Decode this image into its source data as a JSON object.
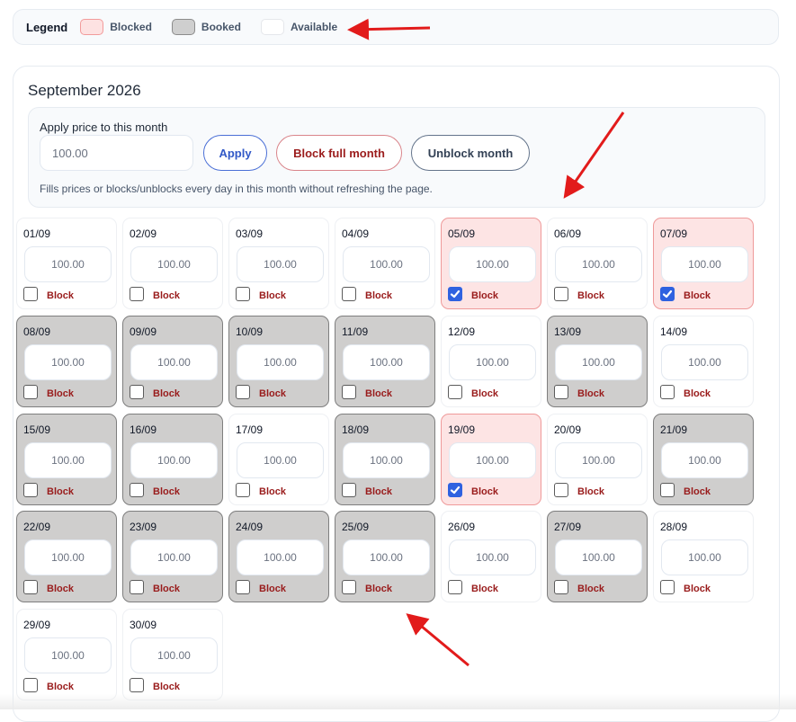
{
  "legend": {
    "title": "Legend",
    "blocked_label": "Blocked",
    "booked_label": "Booked",
    "available_label": "Available",
    "colors": {
      "blocked": "#fde2e2",
      "booked": "#cfcfcf",
      "available": "#ffffff"
    }
  },
  "month": {
    "title": "September 2026",
    "apply_label": "Apply price to this month",
    "price_placeholder": "100.00",
    "apply_button": "Apply",
    "block_month_button": "Block full month",
    "unblock_month_button": "Unblock month",
    "help_text": "Fills prices or blocks/unblocks every day in this month without refreshing the page."
  },
  "day_block_label": "Block",
  "days": [
    {
      "date": "01/09",
      "placeholder": "100.00",
      "status": "available",
      "blocked": false
    },
    {
      "date": "02/09",
      "placeholder": "100.00",
      "status": "available",
      "blocked": false
    },
    {
      "date": "03/09",
      "placeholder": "100.00",
      "status": "available",
      "blocked": false
    },
    {
      "date": "04/09",
      "placeholder": "100.00",
      "status": "available",
      "blocked": false
    },
    {
      "date": "05/09",
      "placeholder": "100.00",
      "status": "blocked",
      "blocked": true
    },
    {
      "date": "06/09",
      "placeholder": "100.00",
      "status": "available",
      "blocked": false
    },
    {
      "date": "07/09",
      "placeholder": "100.00",
      "status": "blocked",
      "blocked": true
    },
    {
      "date": "08/09",
      "placeholder": "100.00",
      "status": "booked",
      "blocked": false
    },
    {
      "date": "09/09",
      "placeholder": "100.00",
      "status": "booked",
      "blocked": false
    },
    {
      "date": "10/09",
      "placeholder": "100.00",
      "status": "booked",
      "blocked": false
    },
    {
      "date": "11/09",
      "placeholder": "100.00",
      "status": "booked",
      "blocked": false
    },
    {
      "date": "12/09",
      "placeholder": "100.00",
      "status": "available",
      "blocked": false
    },
    {
      "date": "13/09",
      "placeholder": "100.00",
      "status": "booked",
      "blocked": false
    },
    {
      "date": "14/09",
      "placeholder": "100.00",
      "status": "available",
      "blocked": false
    },
    {
      "date": "15/09",
      "placeholder": "100.00",
      "status": "booked",
      "blocked": false
    },
    {
      "date": "16/09",
      "placeholder": "100.00",
      "status": "booked",
      "blocked": false
    },
    {
      "date": "17/09",
      "placeholder": "100.00",
      "status": "available",
      "blocked": false
    },
    {
      "date": "18/09",
      "placeholder": "100.00",
      "status": "booked",
      "blocked": false
    },
    {
      "date": "19/09",
      "placeholder": "100.00",
      "status": "blocked",
      "blocked": true
    },
    {
      "date": "20/09",
      "placeholder": "100.00",
      "status": "available",
      "blocked": false
    },
    {
      "date": "21/09",
      "placeholder": "100.00",
      "status": "booked",
      "blocked": false
    },
    {
      "date": "22/09",
      "placeholder": "100.00",
      "status": "booked",
      "blocked": false
    },
    {
      "date": "23/09",
      "placeholder": "100.00",
      "status": "booked",
      "blocked": false
    },
    {
      "date": "24/09",
      "placeholder": "100.00",
      "status": "booked",
      "blocked": false
    },
    {
      "date": "25/09",
      "placeholder": "100.00",
      "status": "booked",
      "blocked": false
    },
    {
      "date": "26/09",
      "placeholder": "100.00",
      "status": "available",
      "blocked": false
    },
    {
      "date": "27/09",
      "placeholder": "100.00",
      "status": "booked",
      "blocked": false
    },
    {
      "date": "28/09",
      "placeholder": "100.00",
      "status": "available",
      "blocked": false
    },
    {
      "date": "29/09",
      "placeholder": "100.00",
      "status": "available",
      "blocked": false
    },
    {
      "date": "30/09",
      "placeholder": "100.00",
      "status": "available",
      "blocked": false
    }
  ]
}
